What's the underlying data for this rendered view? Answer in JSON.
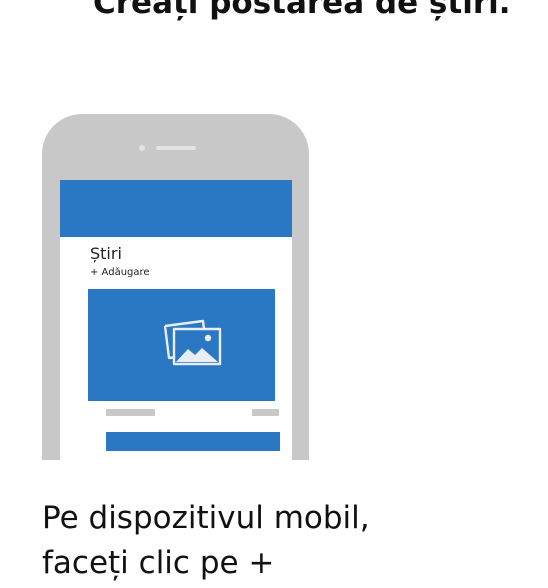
{
  "page": {
    "title": "Creați postarea de știri."
  },
  "phone": {
    "news_title": "Știri",
    "add_label": "+ Adăugare"
  },
  "caption": {
    "line1": "Pe dispozitivul mobil,",
    "line2": "faceți clic pe +"
  },
  "icons": {
    "image": "image-gallery-icon"
  },
  "colors": {
    "accent": "#2a77c4",
    "placeholder": "#c8c8c8",
    "phone_body": "#c8c8c8",
    "text": "#111111"
  }
}
